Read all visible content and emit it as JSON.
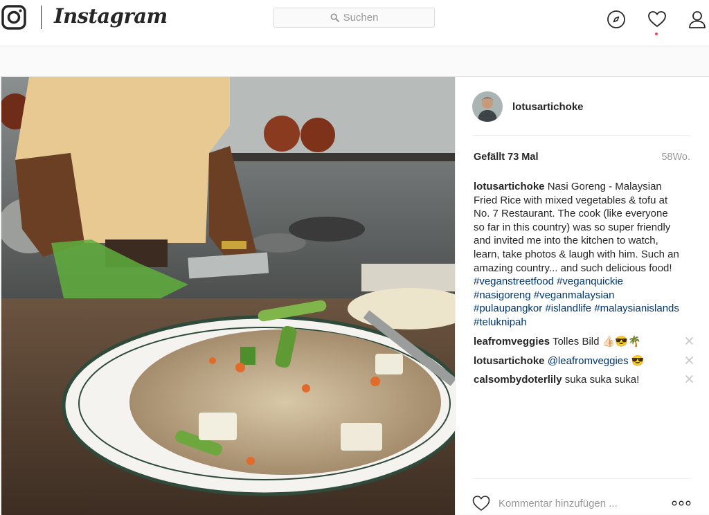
{
  "header": {
    "brand": "Instagram",
    "search_placeholder": "Suchen",
    "nav_icons": [
      "explore-compass-icon",
      "activity-heart-icon",
      "profile-person-icon"
    ],
    "notification_dot_color": "#ed4956"
  },
  "post": {
    "author": "lotusartichoke",
    "likes": "Gefällt 73 Mal",
    "age": "58Wo.",
    "caption": {
      "username": "lotusartichoke",
      "text": "Nasi Goreng - Malaysian Fried Rice with mixed vegetables & tofu at No. 7 Restaurant. The cook (like everyone so far in this country) was so super friendly and invited me into the kitchen to watch, learn, take photos & laugh with him. Such an amazing country... and such delicious food!",
      "hashtags": [
        "#veganstreetfood",
        "#veganquickie",
        "#nasigoreng",
        "#veganmalaysian",
        "#pulaupangkor",
        "#islandlife",
        "#malaysianislands",
        "#teluknipah"
      ],
      "hashtag_color": "#003569"
    },
    "comments": [
      {
        "username": "leafromveggies",
        "text": "Tolles Bild 👍🏻😎🌴",
        "mention": ""
      },
      {
        "username": "lotusartichoke",
        "text": " 😎",
        "mention": "@leafromveggies"
      },
      {
        "username": "calsombydoterlily",
        "text": "suka suka suka!",
        "mention": ""
      }
    ],
    "comment_placeholder": "Kommentar hinzufügen ...",
    "more_options_icon": "more-dots-icon"
  }
}
